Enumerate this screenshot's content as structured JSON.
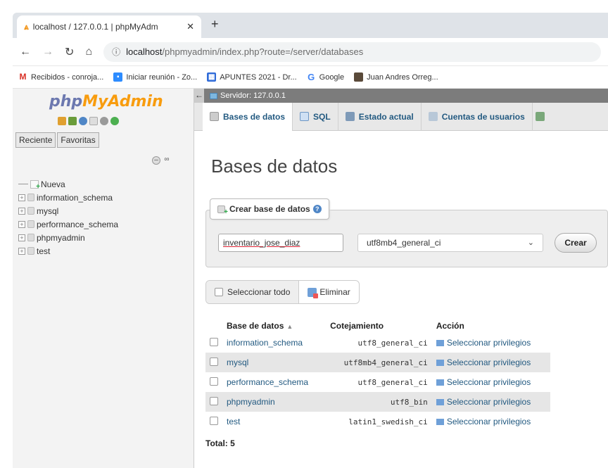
{
  "browser": {
    "tab_title": "localhost / 127.0.0.1 | phpMyAdm",
    "tab_favicon": "pma-icon",
    "url_host": "localhost",
    "url_path": "/phpmyadmin/index.php?route=/server/databases",
    "bookmarks": [
      {
        "label": "Recibidos - conroja...",
        "icon": "gmail-icon",
        "color": "#d93025"
      },
      {
        "label": "Iniciar reunión - Zo...",
        "icon": "zoom-icon",
        "color": "#2d8cff"
      },
      {
        "label": "APUNTES 2021 - Dr...",
        "icon": "trello-icon",
        "color": "#2f6bd8"
      },
      {
        "label": "Google",
        "icon": "google-icon",
        "color": "#4285f4"
      },
      {
        "label": "Juan Andres Orreg...",
        "icon": "profile-icon",
        "color": "#5a4a3a"
      }
    ]
  },
  "sidebar": {
    "logo_php": "php",
    "logo_myadmin": "MyAdmin",
    "tabs": [
      "Reciente",
      "Favoritas"
    ],
    "tree": [
      {
        "label": "Nueva",
        "type": "new"
      },
      {
        "label": "information_schema",
        "type": "db"
      },
      {
        "label": "mysql",
        "type": "db"
      },
      {
        "label": "performance_schema",
        "type": "db"
      },
      {
        "label": "phpmyadmin",
        "type": "db"
      },
      {
        "label": "test",
        "type": "db"
      }
    ]
  },
  "main": {
    "server_label": "Servidor: 127.0.0.1",
    "menu": [
      {
        "label": "Bases de datos",
        "active": true
      },
      {
        "label": "SQL"
      },
      {
        "label": "Estado actual"
      },
      {
        "label": "Cuentas de usuarios"
      }
    ],
    "page_title": "Bases de datos",
    "create": {
      "legend": "Crear base de datos",
      "name_value": "inventario_jose_diaz",
      "collation_value": "utf8mb4_general_ci",
      "button": "Crear"
    },
    "select_all": "Seleccionar todo",
    "delete": "Eliminar",
    "table": {
      "headers": [
        "Base de datos",
        "Cotejamiento",
        "Acción"
      ],
      "rows": [
        {
          "name": "information_schema",
          "collation": "utf8_general_ci",
          "action": "Seleccionar privilegios"
        },
        {
          "name": "mysql",
          "collation": "utf8mb4_general_ci",
          "action": "Seleccionar privilegios"
        },
        {
          "name": "performance_schema",
          "collation": "utf8_general_ci",
          "action": "Seleccionar privilegios"
        },
        {
          "name": "phpmyadmin",
          "collation": "utf8_bin",
          "action": "Seleccionar privilegios"
        },
        {
          "name": "test",
          "collation": "latin1_swedish_ci",
          "action": "Seleccionar privilegios"
        }
      ]
    },
    "total": "Total: 5"
  }
}
